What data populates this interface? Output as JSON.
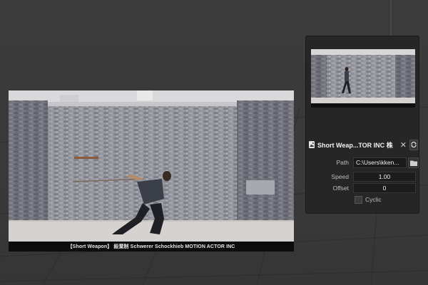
{
  "video": {
    "caption": "【Short Weapon】 殺棄制 Schwerer Schockhieb MOTION ACTOR INC"
  },
  "panel": {
    "title": "Short Weap...TOR INC 株",
    "close_glyph": "✕",
    "path_label": "Path",
    "path_value": "C:\\Users\\kken...",
    "speed_label": "Speed",
    "speed_value": "1.00",
    "offset_label": "Offset",
    "offset_value": "0",
    "cyclic_label": "Cyclic",
    "cyclic_checked": false
  },
  "icons": {
    "header": "image-icon",
    "refresh": "refresh-icon",
    "folder": "folder-icon"
  },
  "colors": {
    "viewport": "#3a3a3a",
    "panel": "#262626",
    "field": "#1c1c1c"
  }
}
